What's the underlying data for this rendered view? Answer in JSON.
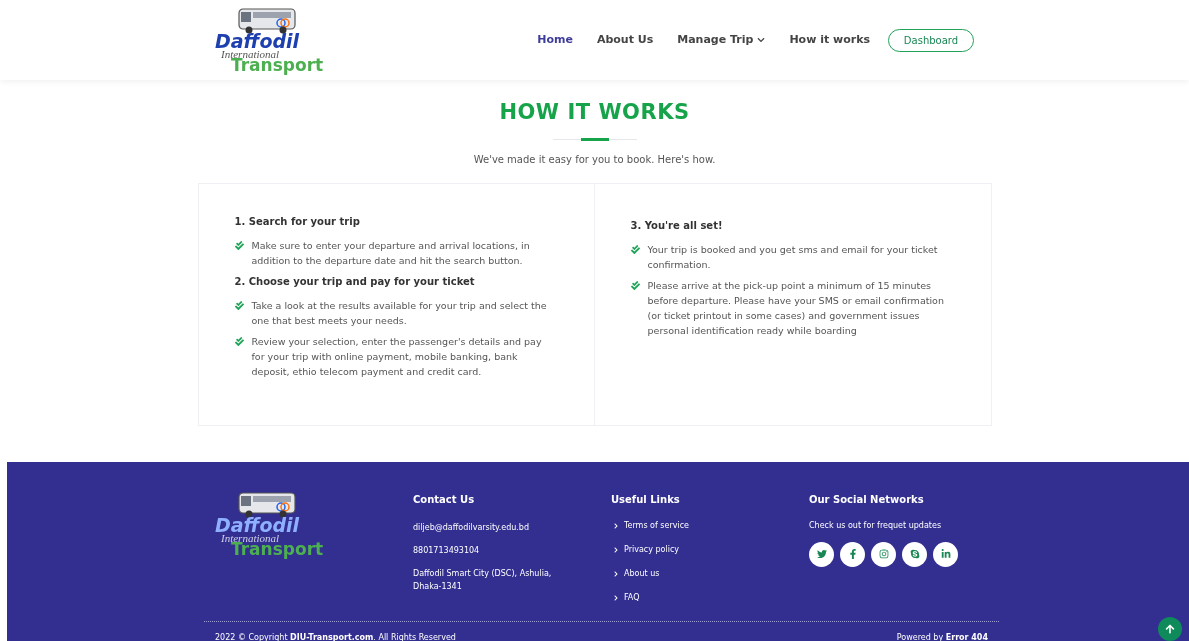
{
  "header": {
    "logo": {
      "line_1": "Daffodil",
      "line_2": "International",
      "line_3": "Transport"
    },
    "nav": [
      {
        "label": "Home",
        "selected": true,
        "kind": "link"
      },
      {
        "label": "About Us",
        "selected": false,
        "kind": "link"
      },
      {
        "label": "Manage Trip",
        "selected": false,
        "kind": "dropdown"
      },
      {
        "label": "How it works",
        "selected": false,
        "kind": "link"
      }
    ],
    "button": "Dashboard"
  },
  "section": {
    "title": "HOW IT WORKS",
    "subtitle": "We've made it easy for you to book. Here's how.",
    "columns": [
      [
        {
          "heading": "1. Search for your trip",
          "items": [
            "Make sure to enter your departure and arrival locations, in addition to the departure date and hit the search button."
          ]
        },
        {
          "heading": "2. Choose your trip and pay for your ticket",
          "items": [
            "Take a look at the results available for your trip and select the one that best meets your needs.",
            "Review your selection, enter the passenger's details and pay for your trip with online payment, mobile banking, bank deposit, ethio telecom payment and credit card."
          ]
        }
      ],
      [
        {
          "heading": "3. You're all set!",
          "items": [
            "Your trip is booked and you get sms and email for your ticket confirmation.",
            "Please arrive at the pick-up point a minimum of 15 minutes before departure. Please have your SMS or email confirmation (or ticket printout in some cases) and government issues personal identification ready while boarding"
          ]
        }
      ]
    ]
  },
  "footer": {
    "logo": {
      "line_1": "Daffodil",
      "line_2": "International",
      "line_3": "Transport"
    },
    "contact": {
      "title": "Contact Us",
      "lines": [
        "diljeb@daffodilvarsity.edu.bd",
        "8801713493104",
        "Daffodil Smart City (DSC), Ashulia, Dhaka-1341"
      ]
    },
    "links": {
      "title": "Useful Links",
      "items": [
        "Terms of service",
        "Privacy policy",
        "About us",
        "FAQ"
      ]
    },
    "social": {
      "title": "Our Social Networks",
      "text": "Check us out for frequet updates",
      "networks": [
        {
          "kind": "twitter"
        },
        {
          "kind": "facebook"
        },
        {
          "kind": "instagram"
        },
        {
          "kind": "skype"
        },
        {
          "kind": "linkedin"
        }
      ]
    },
    "copyright": "2022 © Copyright **DIU-Transport.com**. All Rights Reserved",
    "powered": "Powered by **Error 404**"
  }
}
